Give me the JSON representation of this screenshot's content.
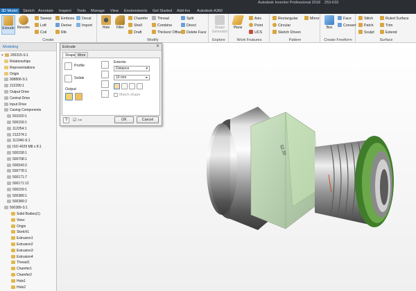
{
  "app": {
    "title": "Autodesk Inventor Professional 2018",
    "document": "253-633"
  },
  "tabs": [
    {
      "label": "3D Model",
      "active": true
    },
    {
      "label": "Sketch"
    },
    {
      "label": "Annotate"
    },
    {
      "label": "Inspect"
    },
    {
      "label": "Tools"
    },
    {
      "label": "Manage"
    },
    {
      "label": "View"
    },
    {
      "label": "Environments"
    },
    {
      "label": "Get Started"
    },
    {
      "label": "Add-Ins"
    },
    {
      "label": "Autodesk A360"
    }
  ],
  "ribbon": {
    "create": {
      "title": "Create",
      "extrude": "Extrude",
      "revolve": "Revolve",
      "sweep": "Sweep",
      "loft": "Loft",
      "coil": "Coil",
      "emboss": "Emboss",
      "derive": "Derive",
      "rib": "Rib",
      "decal": "Decal",
      "import": "Import"
    },
    "modify": {
      "title": "Modify",
      "hole": "Hole",
      "fillet": "Fillet",
      "chamfer": "Chamfer",
      "shell": "Shell",
      "draft": "Draft",
      "thread": "Thread",
      "combine": "Combine",
      "thicken": "Thicken/ Offset",
      "split": "Split",
      "direct": "Direct",
      "delete_face": "Delete Face"
    },
    "explore": {
      "title": "Explore",
      "shape_generator": "Shape Generator"
    },
    "work": {
      "title": "Work Features",
      "plane": "Plane",
      "axis": "Axis",
      "point": "Point",
      "ucs": "UCS"
    },
    "pattern": {
      "title": "Pattern",
      "rectangular": "Rectangular",
      "circular": "Circular",
      "sketch_driven": "Sketch Driven",
      "mirror": "Mirror"
    },
    "freeform": {
      "title": "Create Freeform",
      "box": "Box",
      "face": "Face",
      "convert": "Convert"
    },
    "surface": {
      "title": "Surface",
      "stitch": "Stitch",
      "patch": "Patch",
      "sculpt": "Sculpt",
      "ruled": "Ruled Surface",
      "trim": "Trim",
      "extend": "Extend"
    }
  },
  "browser": {
    "tab": "Modeling",
    "root": "200315-S:1",
    "items": [
      "Relationships",
      "Representations",
      "Origin",
      "908806-S:1",
      "212290:1",
      "Output Drive",
      "Central Drive",
      "Input Drive",
      "Casing Components",
      "501020:1",
      "500159:1",
      "112254:1",
      "212274:1",
      "112340-S:1",
      "ISO 4029 M8 x 8:1",
      "500158:1",
      "500708:1",
      "500543:2",
      "500778:1",
      "500171:7",
      "500171:12",
      "500159:1",
      "500389:1",
      "500389:2",
      "500389-S:1",
      "Solid Bodies(1)",
      "View:",
      "Origin",
      "Sketch1",
      "Extrusion1",
      "Extrusion2",
      "Extrusion3",
      "Extrusion4",
      "Thread1",
      "Chamfer1",
      "Chamfer2",
      "Hole1",
      "Hole2"
    ]
  },
  "dialog": {
    "title": "Extrude",
    "tab_shape": "Shape",
    "tab_more": "More",
    "profile": "Profile",
    "solids": "Solids",
    "output": "Output",
    "extents": "Extents",
    "extents_value": "Distance",
    "distance_value": "10 mm",
    "match_shape": "Match shape",
    "ok": "OK",
    "cancel": "Cancel",
    "help": "?"
  },
  "viewport": {
    "dimension_label": "52.33"
  },
  "colors": {
    "accent": "#1f6fb8",
    "green": "#3f7d2a",
    "highlight": "#b8e3a8"
  }
}
